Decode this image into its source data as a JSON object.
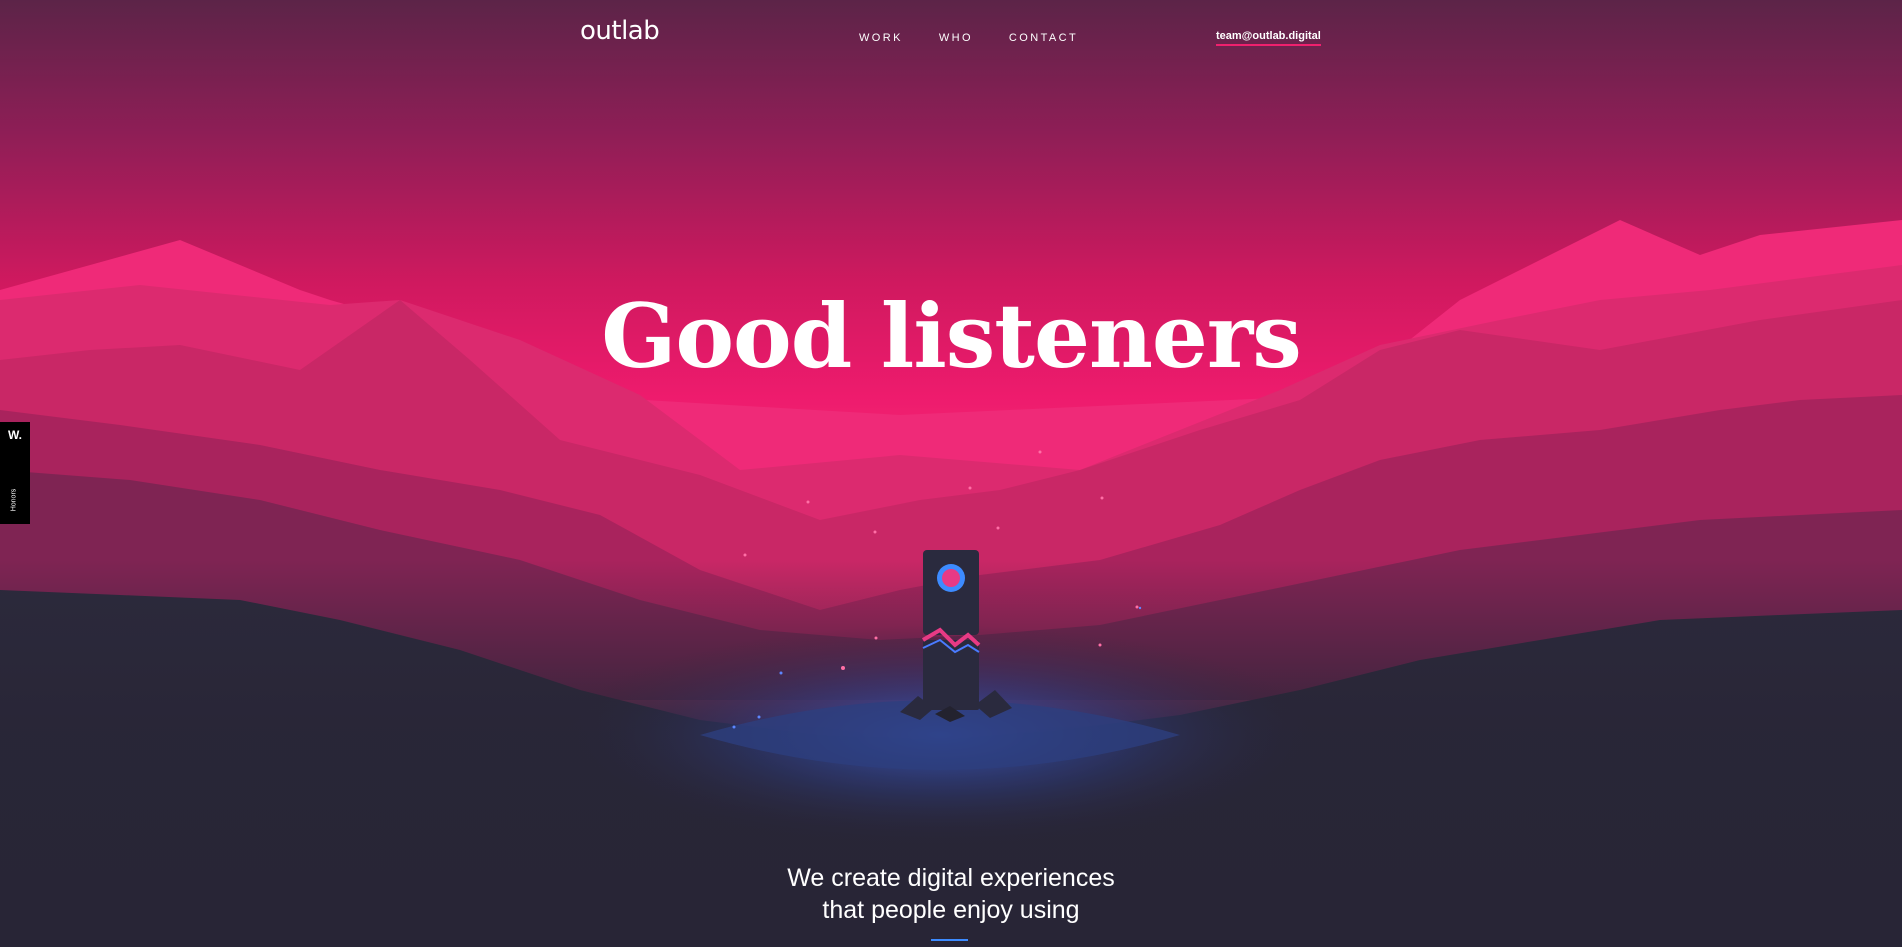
{
  "header": {
    "logo": "outlab",
    "nav": [
      "WORK",
      "WHO",
      "CONTACT"
    ],
    "email": "team@outlab.digital"
  },
  "hero": {
    "headline": "Good listeners"
  },
  "intro": {
    "line1": "We create digital experiences",
    "line2": "that people enjoy using"
  },
  "honors_badge": {
    "mark": "W.",
    "label": "Honors"
  },
  "colors": {
    "sky_top": "#5c2448",
    "sky_mid": "#e8186a",
    "ground": "#282536",
    "accent_pink": "#f0206e",
    "accent_blue": "#3d8bff"
  }
}
